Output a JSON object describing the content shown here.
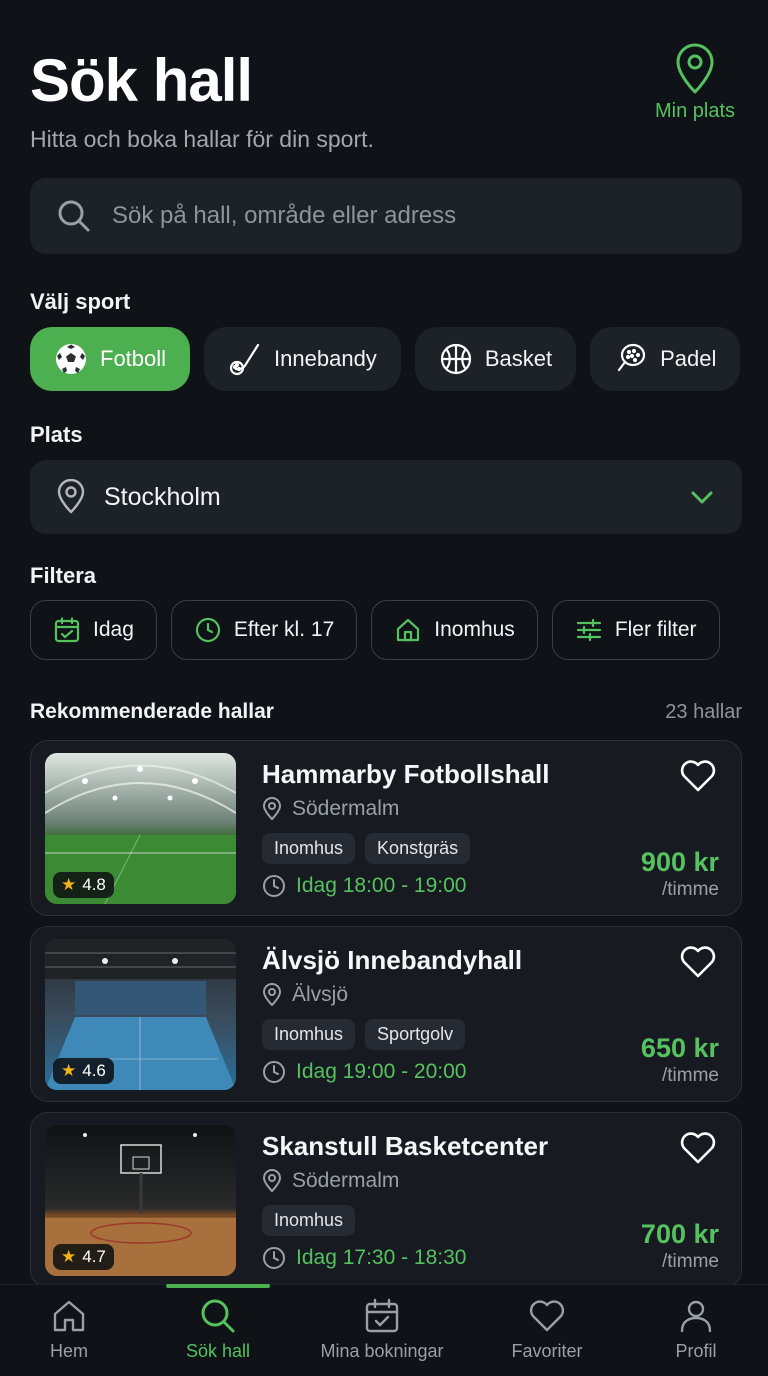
{
  "header": {
    "title": "Sök hall",
    "subtitle": "Hitta och boka hallar för din sport.",
    "location_button": "Min plats"
  },
  "search": {
    "placeholder": "Sök på hall, område eller adress"
  },
  "sport": {
    "label": "Välj sport",
    "options": [
      {
        "label": "Fotboll",
        "icon": "soccer-ball-icon",
        "selected": true
      },
      {
        "label": "Innebandy",
        "icon": "floorball-icon",
        "selected": false
      },
      {
        "label": "Basket",
        "icon": "basketball-icon",
        "selected": false
      },
      {
        "label": "Padel",
        "icon": "padel-racket-icon",
        "selected": false
      }
    ]
  },
  "place": {
    "label": "Plats",
    "value": "Stockholm"
  },
  "filters": {
    "label": "Filtera",
    "items": [
      {
        "label": "Idag",
        "icon": "calendar-icon"
      },
      {
        "label": "Efter kl. 17",
        "icon": "clock-icon"
      },
      {
        "label": "Inomhus",
        "icon": "home-icon"
      },
      {
        "label": "Fler filter",
        "icon": "sliders-icon"
      }
    ]
  },
  "recommended": {
    "title": "Rekommenderade hallar",
    "count": "23 hallar",
    "halls": [
      {
        "name": "Hammarby Fotbollshall",
        "area": "Södermalm",
        "tags": [
          "Inomhus",
          "Konstgräs"
        ],
        "time": "Idag 18:00 - 19:00",
        "price": "900 kr",
        "unit": "/timme",
        "rating": "4.8"
      },
      {
        "name": "Älvsjö Innebandyhall",
        "area": "Älvsjö",
        "tags": [
          "Inomhus",
          "Sportgolv"
        ],
        "time": "Idag 19:00 - 20:00",
        "price": "650 kr",
        "unit": "/timme",
        "rating": "4.6"
      },
      {
        "name": "Skanstull Basketcenter",
        "area": "Södermalm",
        "tags": [
          "Inomhus"
        ],
        "time": "Idag 17:30 - 18:30",
        "price": "700 kr",
        "unit": "/timme",
        "rating": "4.7"
      }
    ]
  },
  "nav": {
    "items": [
      {
        "label": "Hem",
        "icon": "home-icon"
      },
      {
        "label": "Sök hall",
        "icon": "search-icon",
        "active": true
      },
      {
        "label": "Mina bokningar",
        "icon": "calendar-icon"
      },
      {
        "label": "Favoriter",
        "icon": "heart-icon"
      },
      {
        "label": "Profil",
        "icon": "user-icon"
      }
    ]
  },
  "colors": {
    "accent": "#4cb050",
    "accent_text": "#55c25f",
    "background": "#0f1217",
    "surface": "#1d2229"
  }
}
